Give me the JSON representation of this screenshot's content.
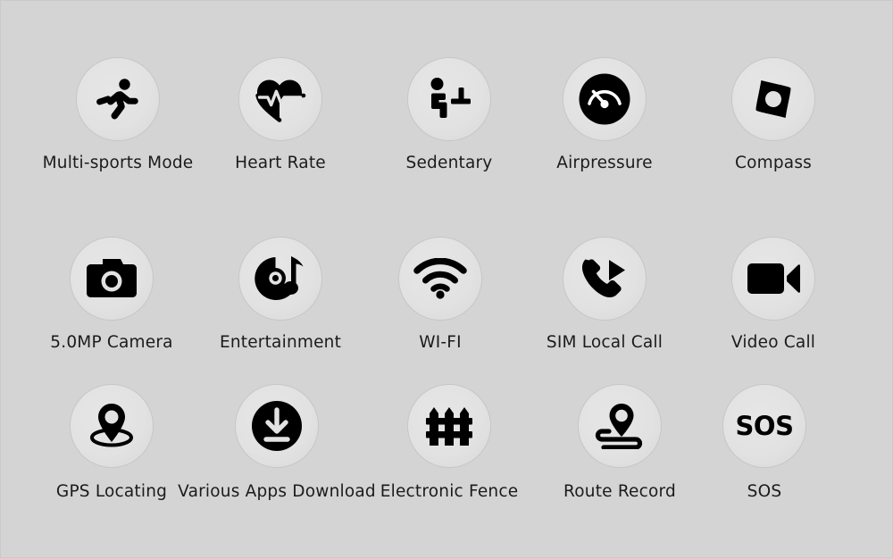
{
  "page": {
    "background_color": "#d4d4d4",
    "circle_color": "#e2e2e2",
    "icon_color": "#000000",
    "label_color": "#1b1b1b",
    "columns": 5,
    "rows": 3
  },
  "features": [
    {
      "label": "Multi-sports Mode",
      "icon": "running-person-icon"
    },
    {
      "label": "Heart Rate",
      "icon": "heart-pulse-icon"
    },
    {
      "label": "Sedentary",
      "icon": "person-sitting-desk-icon"
    },
    {
      "label": "Airpressure",
      "icon": "gauge-icon"
    },
    {
      "label": "Compass",
      "icon": "compass-needle-icon"
    },
    {
      "label": "5.0MP Camera",
      "icon": "camera-icon"
    },
    {
      "label": "Entertainment",
      "icon": "vinyl-music-note-icon"
    },
    {
      "label": "WI-FI",
      "icon": "wifi-icon"
    },
    {
      "label": "SIM Local Call",
      "icon": "phone-outgoing-call-icon"
    },
    {
      "label": "Video Call",
      "icon": "video-camera-icon"
    },
    {
      "label": "GPS Locating",
      "icon": "map-pin-locating-icon"
    },
    {
      "label": "Various Apps Download",
      "icon": "download-circle-icon"
    },
    {
      "label": "Electronic Fence",
      "icon": "fence-icon"
    },
    {
      "label": "Route Record",
      "icon": "route-pin-path-icon"
    },
    {
      "label": "SOS",
      "icon": "sos-text-icon",
      "icon_text": "SOS"
    }
  ]
}
